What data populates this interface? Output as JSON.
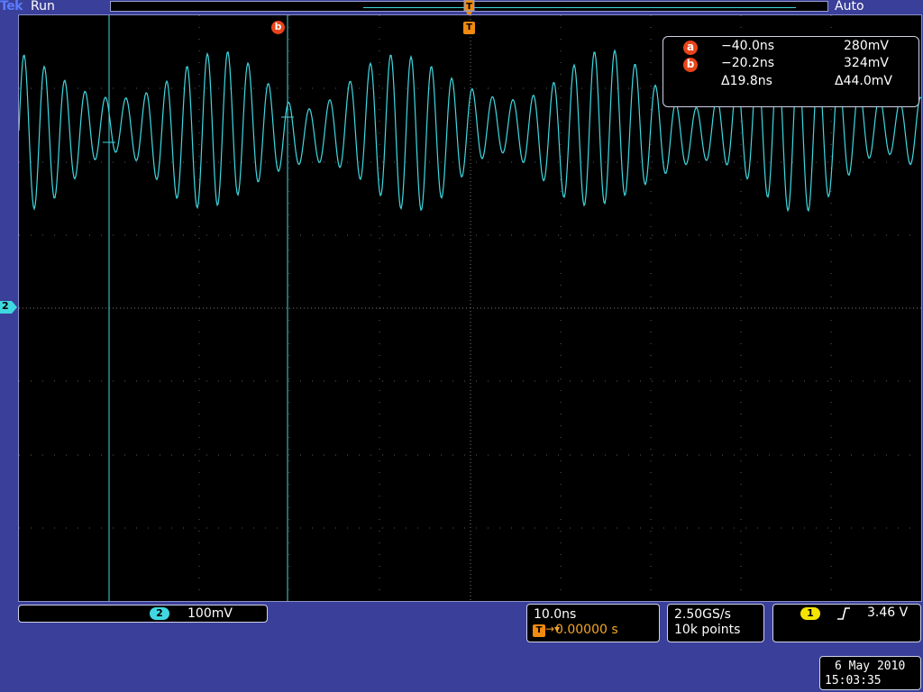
{
  "header": {
    "brand": "Tek",
    "run_state": "Run",
    "trigger_mode": "Auto"
  },
  "channel_marker": {
    "label": "2",
    "color": "#3fd8e0"
  },
  "markers": {
    "cursor_b": "b",
    "trigger": "T"
  },
  "cursor_readout": {
    "a": {
      "label": "a",
      "time": "−40.0ns",
      "voltage": "280mV"
    },
    "b": {
      "label": "b",
      "time": "−20.2ns",
      "voltage": "324mV"
    },
    "delta": {
      "time": "Δ19.8ns",
      "voltage": "Δ44.0mV"
    }
  },
  "channel2": {
    "label": "2",
    "scale": "100mV"
  },
  "timebase": {
    "scale": "10.0ns",
    "trigger_icon": "T",
    "position": "0.00000 s"
  },
  "acquisition": {
    "sample_rate": "2.50GS/s",
    "record_length": "10k points"
  },
  "trigger": {
    "source": "1",
    "slope_icon": "rising-edge-icon",
    "level": "3.46 V"
  },
  "datetime": {
    "date": "6 May 2010",
    "time": "15:03:35"
  },
  "colors": {
    "background": "#3a3f99",
    "trace": "#3fd8e0",
    "cursor_badge": "#e8441a",
    "trigger_marker": "#f08a10",
    "trigger_source": "#f5e400"
  },
  "chart_data": {
    "type": "line",
    "title": "",
    "xlabel": "",
    "ylabel": "",
    "xlim": [
      -50,
      50
    ],
    "ylim": [
      -400,
      400
    ],
    "grid": true,
    "series": [
      {
        "name": "",
        "x_unit": "ns",
        "y_unit": "mV",
        "description_points": []
      }
    ]
  }
}
